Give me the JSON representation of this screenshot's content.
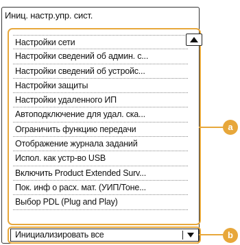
{
  "screen": {
    "title": "Иниц. настр.упр. сист."
  },
  "settings_list": {
    "items": [
      "Настройки сети",
      "Настройки сведений об админ. с...",
      "Настройки сведений об устройс...",
      "Настройки защиты",
      "Настройки удаленного ИП",
      "Автоподключение для удал. ска...",
      "Ограничить функцию передачи",
      "Отображение журнала заданий",
      "Испол. как устр-во USB",
      "Включить Product Extended Surv...",
      "Пок. инф о расх. мат. (УИП/Тоне...",
      "Выбор PDL (Plug and Play)"
    ]
  },
  "select": {
    "value": "Инициализировать все"
  },
  "callouts": {
    "a": "a",
    "b": "b"
  },
  "icons": {
    "scroll_up": "triangle-up-icon",
    "dropdown": "triangle-down-icon"
  },
  "colors": {
    "highlight": "#e7a73a"
  }
}
